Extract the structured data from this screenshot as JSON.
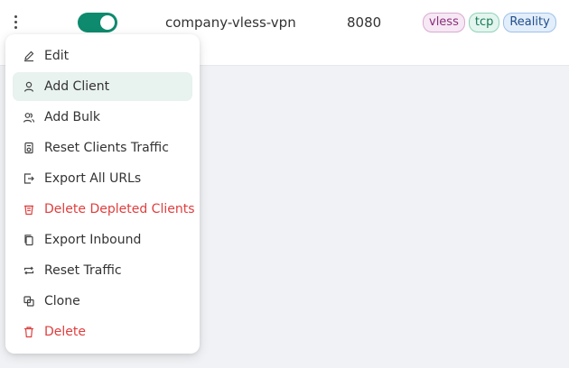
{
  "inbound": {
    "remark": "company-vless-vpn",
    "port": "8080",
    "enabled": true,
    "tags": [
      "vless",
      "tcp",
      "Reality"
    ]
  },
  "menu": {
    "items": [
      {
        "label": "Edit",
        "icon": "edit-icon"
      },
      {
        "label": "Add Client",
        "icon": "user-icon",
        "active": true
      },
      {
        "label": "Add Bulk",
        "icon": "users-icon"
      },
      {
        "label": "Reset Clients Traffic",
        "icon": "reset-file-icon"
      },
      {
        "label": "Export All URLs",
        "icon": "export-icon"
      },
      {
        "label": "Delete Depleted Clients",
        "icon": "rest-icon",
        "danger": true
      },
      {
        "label": "Export Inbound",
        "icon": "copy-icon"
      },
      {
        "label": "Reset Traffic",
        "icon": "retweet-icon"
      },
      {
        "label": "Clone",
        "icon": "block-icon"
      },
      {
        "label": "Delete",
        "icon": "trash-icon",
        "danger": true
      }
    ]
  },
  "colors": {
    "accent": "#0e8a6e",
    "danger": "#e03e3e",
    "active_bg": "#e8f2ef"
  }
}
